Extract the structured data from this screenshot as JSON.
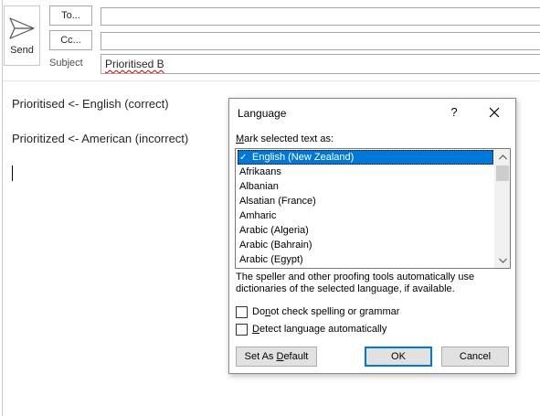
{
  "compose": {
    "send_label": "Send",
    "to_label": "To...",
    "cc_label": "Cc...",
    "subject_label": "Subject",
    "subject_value": "Prioritised B",
    "to_value": "",
    "cc_value": ""
  },
  "body": {
    "line1": "Prioritised <- English (correct)",
    "line2": "Prioritized <- American (incorrect)"
  },
  "dialog": {
    "title": "Language",
    "help_label": "?",
    "mark_label_prefix": "",
    "mark_label_accel": "M",
    "mark_label_rest": "ark selected text as:",
    "languages": [
      "English (New Zealand)",
      "Afrikaans",
      "Albanian",
      "Alsatian (France)",
      "Amharic",
      "Arabic (Algeria)",
      "Arabic (Bahrain)",
      "Arabic (Egypt)"
    ],
    "selected_check": "✓",
    "proof_note": "The speller and other proofing tools automatically use dictionaries of the selected language, if available.",
    "no_check_pre": "Do ",
    "no_check_accel": "n",
    "no_check_post": "ot check spelling or grammar",
    "detect_pre": "",
    "detect_accel": "D",
    "detect_post": "etect language automatically",
    "default_pre": "Set As ",
    "default_accel": "D",
    "default_post": "efault",
    "ok_label": "OK",
    "cancel_label": "Cancel"
  },
  "colors": {
    "selection": "#0078d7",
    "border": "#a8a8a8",
    "spell_error": "#d00000"
  }
}
